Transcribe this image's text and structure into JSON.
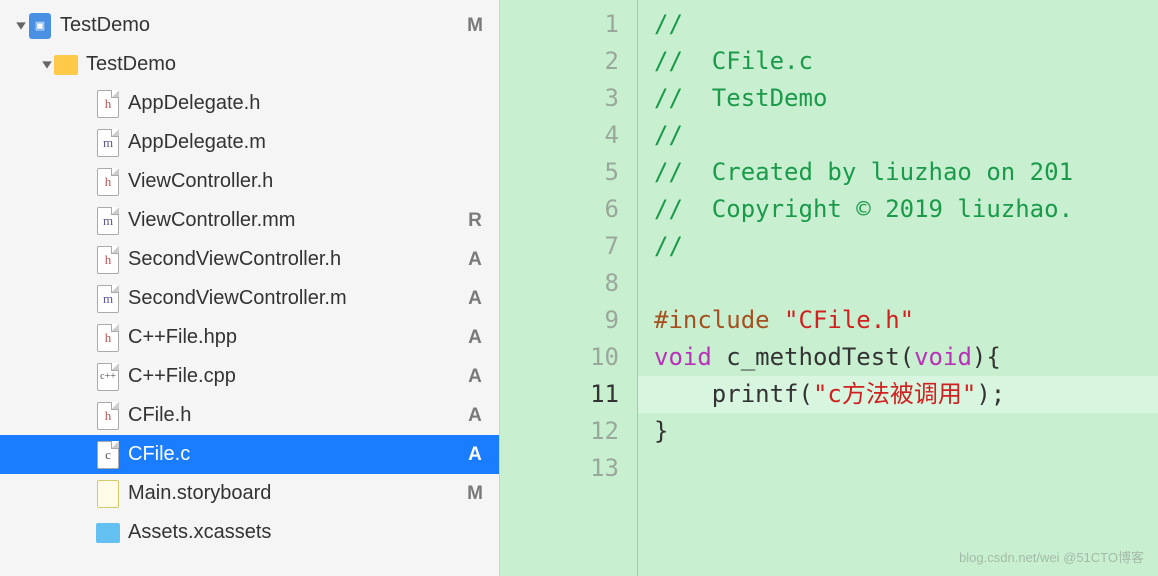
{
  "sidebar": {
    "project": {
      "name": "TestDemo",
      "status": "M"
    },
    "folder": {
      "name": "TestDemo"
    },
    "files": [
      {
        "name": "AppDelegate.h",
        "icon": "h",
        "status": ""
      },
      {
        "name": "AppDelegate.m",
        "icon": "m",
        "status": ""
      },
      {
        "name": "ViewController.h",
        "icon": "h",
        "status": ""
      },
      {
        "name": "ViewController.mm",
        "icon": "m",
        "status": "R"
      },
      {
        "name": "SecondViewController.h",
        "icon": "h",
        "status": "A"
      },
      {
        "name": "SecondViewController.m",
        "icon": "m",
        "status": "A"
      },
      {
        "name": "C++File.hpp",
        "icon": "h",
        "status": "A"
      },
      {
        "name": "C++File.cpp",
        "icon": "c++",
        "status": "A"
      },
      {
        "name": "CFile.h",
        "icon": "h",
        "status": "A"
      },
      {
        "name": "CFile.c",
        "icon": "c",
        "status": "A",
        "selected": true
      },
      {
        "name": "Main.storyboard",
        "icon": "storyboard",
        "status": "M"
      },
      {
        "name": "Assets.xcassets",
        "icon": "folder-blue",
        "status": ""
      }
    ]
  },
  "editor": {
    "current_line": 11,
    "lines": [
      {
        "n": 1,
        "tokens": [
          {
            "t": "//",
            "c": "cm"
          }
        ]
      },
      {
        "n": 2,
        "tokens": [
          {
            "t": "//  CFile.c",
            "c": "cm"
          }
        ]
      },
      {
        "n": 3,
        "tokens": [
          {
            "t": "//  TestDemo",
            "c": "cm"
          }
        ]
      },
      {
        "n": 4,
        "tokens": [
          {
            "t": "//",
            "c": "cm"
          }
        ]
      },
      {
        "n": 5,
        "tokens": [
          {
            "t": "//  Created by liuzhao on 201",
            "c": "cm"
          }
        ]
      },
      {
        "n": 6,
        "tokens": [
          {
            "t": "//  Copyright © 2019 liuzhao.",
            "c": "cm"
          }
        ]
      },
      {
        "n": 7,
        "tokens": [
          {
            "t": "//",
            "c": "cm"
          }
        ]
      },
      {
        "n": 8,
        "tokens": []
      },
      {
        "n": 9,
        "tokens": [
          {
            "t": "#include ",
            "c": "pp"
          },
          {
            "t": "\"CFile.h\"",
            "c": "str"
          }
        ]
      },
      {
        "n": 10,
        "tokens": [
          {
            "t": "void",
            "c": "kw"
          },
          {
            "t": " c_methodTest(",
            "c": "id"
          },
          {
            "t": "void",
            "c": "kw"
          },
          {
            "t": "){",
            "c": "id"
          }
        ]
      },
      {
        "n": 11,
        "tokens": [
          {
            "t": "    printf(",
            "c": "fn"
          },
          {
            "t": "\"c方法被调用\"",
            "c": "str"
          },
          {
            "t": ");",
            "c": "id"
          }
        ]
      },
      {
        "n": 12,
        "tokens": [
          {
            "t": "}",
            "c": "id"
          }
        ]
      },
      {
        "n": 13,
        "tokens": []
      }
    ]
  },
  "watermark": "blog.csdn.net/wei  @51CTO博客"
}
